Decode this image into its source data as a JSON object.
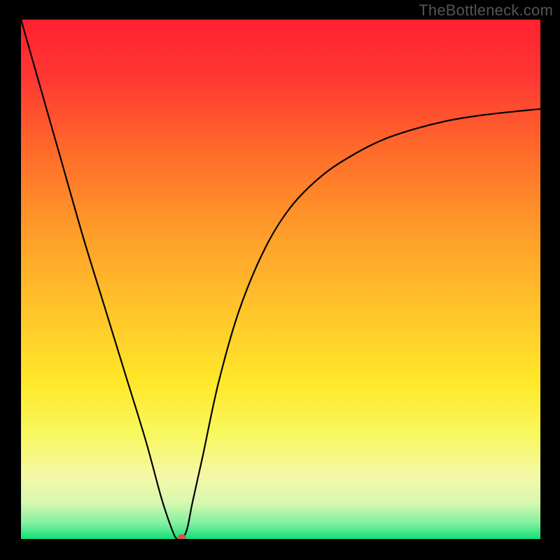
{
  "watermark": "TheBottleneck.com",
  "chart_data": {
    "type": "line",
    "title": "",
    "xlabel": "",
    "ylabel": "",
    "xlim": [
      0,
      100
    ],
    "ylim": [
      0,
      100
    ],
    "legend": false,
    "grid": false,
    "background_gradient": {
      "type": "vertical",
      "stops": [
        {
          "offset": 0.0,
          "color": "#ff2030"
        },
        {
          "offset": 0.12,
          "color": "#ff3a33"
        },
        {
          "offset": 0.25,
          "color": "#ff6a2a"
        },
        {
          "offset": 0.4,
          "color": "#ff9a2a"
        },
        {
          "offset": 0.55,
          "color": "#ffc22a"
        },
        {
          "offset": 0.7,
          "color": "#ffe82a"
        },
        {
          "offset": 0.8,
          "color": "#f8f860"
        },
        {
          "offset": 0.88,
          "color": "#f4f8a8"
        },
        {
          "offset": 0.93,
          "color": "#d8f8b0"
        },
        {
          "offset": 0.97,
          "color": "#80f0a0"
        },
        {
          "offset": 1.0,
          "color": "#10e078"
        }
      ]
    },
    "series": [
      {
        "name": "bottleneck-curve",
        "color": "#000000",
        "x": [
          0,
          4,
          8,
          12,
          16,
          20,
          24,
          27,
          29,
          30,
          31,
          32,
          33,
          35,
          38,
          42,
          47,
          52,
          58,
          64,
          70,
          76,
          82,
          88,
          94,
          100
        ],
        "y": [
          100,
          86,
          72,
          58,
          45,
          32,
          19,
          8,
          2,
          0,
          0,
          2,
          7,
          16,
          30,
          44,
          56,
          64,
          70,
          74,
          77,
          79,
          80.5,
          81.5,
          82.2,
          82.8
        ]
      }
    ],
    "marker": {
      "name": "min-point-marker",
      "x": 31,
      "y": 0,
      "color": "#cc5a4a",
      "rx": 6,
      "ry": 5
    },
    "note": "V-shaped bottleneck curve over rainbow performance gradient; minimum (optimal match) at roughly x≈31 where score is ~0. Axes are unlabeled in the source image; values are estimated on a 0–100 normalized scale from pixel positions."
  }
}
